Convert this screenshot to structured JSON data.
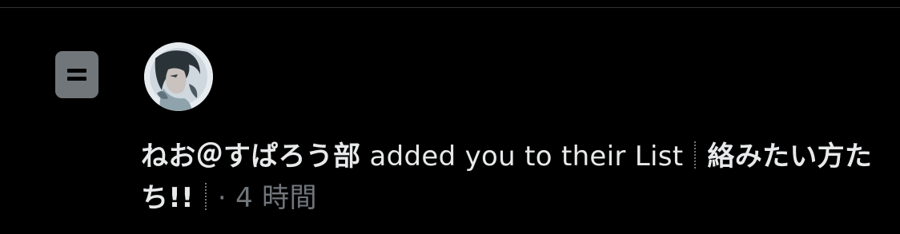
{
  "notification": {
    "user_name": "ねお＠すぱろう部",
    "action": "added you to their List",
    "list_name": "絡みたい方たち!!",
    "time_separator": "·",
    "time": "4 時間"
  },
  "icons": {
    "list_icon": "list-icon",
    "avatar": "user-avatar"
  },
  "colors": {
    "background": "#000000",
    "text_primary": "#e7e9ea",
    "text_secondary": "#71767b",
    "icon_gray": "#71767b"
  }
}
